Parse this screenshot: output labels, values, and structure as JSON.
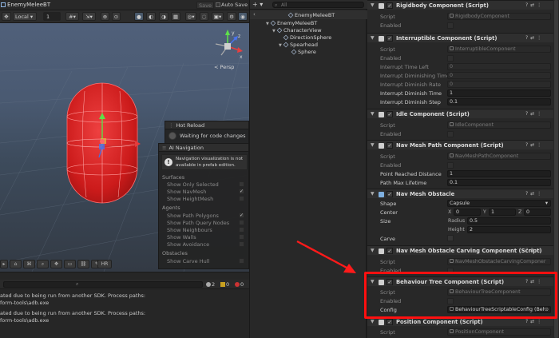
{
  "scene": {
    "tab_title": "EnemyMeleeBT",
    "save_label": "Save",
    "autosave_label": "Auto Save",
    "pivot_mode": "Local",
    "grid_value": "1",
    "persp_label": "< Persp",
    "gizmo_axes": {
      "x": "x",
      "y": "y",
      "z": "z"
    }
  },
  "hot_reload": {
    "title": "Hot Reload",
    "status": "Waiting for code changes"
  },
  "ai_navigation": {
    "title": "AI Navigation",
    "notice_line1": "Navigation visualization is not",
    "notice_line2": "available in prefab edition.",
    "surfaces_header": "Surfaces",
    "surfaces": [
      {
        "label": "Show Only Selected",
        "checked": false
      },
      {
        "label": "Show NavMesh",
        "checked": true
      },
      {
        "label": "Show HeightMesh",
        "checked": false
      }
    ],
    "agents_header": "Agents",
    "agents": [
      {
        "label": "Show Path Polygons",
        "checked": true
      },
      {
        "label": "Show Path Query Nodes",
        "checked": false
      },
      {
        "label": "Show Neighbours",
        "checked": false
      },
      {
        "label": "Show Walls",
        "checked": false
      },
      {
        "label": "Show Avoidance",
        "checked": false
      }
    ],
    "obstacles_header": "Obstacles",
    "obstacles": [
      {
        "label": "Show Carve Hull",
        "checked": false
      }
    ]
  },
  "bottom_tools": {
    "hr_label": "HR"
  },
  "console": {
    "counts": {
      "warnings": "2",
      "errors": "0",
      "messages": "0"
    },
    "lines": [
      "ated due to being run from another SDK. Process paths:",
      "form-tools\\adb.exe",
      "ated due to being run from another SDK. Process paths:",
      "form-tools\\adb.exe"
    ]
  },
  "hierarchy": {
    "search_placeholder": "All",
    "root": "EnemyMeleeBT",
    "items": [
      {
        "label": "CharacterView",
        "depth": 1,
        "expanded": true
      },
      {
        "label": "DirectionSphere",
        "depth": 2,
        "expanded": false
      },
      {
        "label": "Spearhead",
        "depth": 2,
        "expanded": true
      },
      {
        "label": "Sphere",
        "depth": 3,
        "expanded": false
      }
    ]
  },
  "inspector": {
    "components": {
      "rigidbody": {
        "name": "Rigidbody Component (Script)",
        "script_label": "Script",
        "script_value": "RigidbodyComponent",
        "enabled_label": "Enabled"
      },
      "interruptible": {
        "name": "Interruptible Component (Script)",
        "script_label": "Script",
        "script_value": "InterruptibleComponent",
        "enabled_label": "Enabled",
        "props": [
          {
            "label": "Interrupt Time Left",
            "value": "0",
            "editable": false
          },
          {
            "label": "Interrupt Diminishing Time",
            "value": "0",
            "editable": false
          },
          {
            "label": "Interrupt Diminish Rate",
            "value": "0",
            "editable": false
          },
          {
            "label": "Interrupt Diminish Time",
            "value": "1",
            "editable": true
          },
          {
            "label": "Interrupt Diminish Step",
            "value": "0.1",
            "editable": true
          }
        ]
      },
      "idle": {
        "name": "Idle Component (Script)",
        "script_label": "Script",
        "script_value": "IdleComponent",
        "enabled_label": "Enabled"
      },
      "navmesh_path": {
        "name": "Nav Mesh Path Component (Script)",
        "script_label": "Script",
        "script_value": "NavMeshPathComponent",
        "enabled_label": "Enabled",
        "props": [
          {
            "label": "Point Reached Distance",
            "value": "1",
            "editable": true
          },
          {
            "label": "Path Max Lifetime",
            "value": "0.1",
            "editable": true
          }
        ]
      },
      "navmesh_obstacle": {
        "name": "Nav Mesh Obstacle",
        "shape_label": "Shape",
        "shape_value": "Capsule",
        "center_label": "Center",
        "center": {
          "x": "0",
          "y": "1",
          "z": "0"
        },
        "size_label": "Size",
        "radius_label": "Radius",
        "radius_value": "0.5",
        "height_label": "Height",
        "height_value": "2",
        "carve_label": "Carve"
      },
      "navmesh_carving": {
        "name": "Nav Mesh Obstacle Carving Component (Script)",
        "script_label": "Script",
        "script_value": "NavMeshObstacleCarvingComponer",
        "enabled_label": "Enabled"
      },
      "behaviour_tree": {
        "name": "Behaviour Tree Component (Script)",
        "script_label": "Script",
        "script_value": "BehaviourTreeComponent",
        "enabled_label": "Enabled",
        "config_label": "Config",
        "config_value": "BehaviourTreeScriptableConfig (Beha"
      },
      "position": {
        "name": "Position Component (Script)",
        "script_label": "Script",
        "script_value": "PositionComponent"
      }
    }
  },
  "colors": {
    "annotation_red": "#ff1010",
    "capsule_red": "#d21a1a",
    "selection_blue": "#4a5a6c"
  }
}
